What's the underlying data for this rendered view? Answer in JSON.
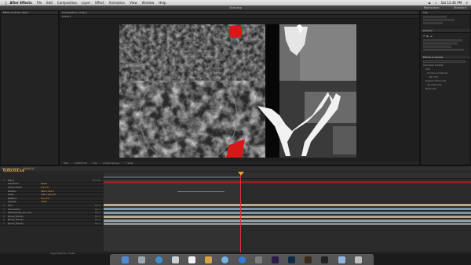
{
  "menubar": {
    "app": "After Effects",
    "items": [
      "File",
      "Edit",
      "Composition",
      "Layer",
      "Effect",
      "Animation",
      "View",
      "Window",
      "Help"
    ],
    "clock": "Sat 12:46 PM"
  },
  "titlebar": {
    "title": "Shot.aep",
    "workspace_label": "Workspace:",
    "workspace_value": "Standard"
  },
  "left_panel": {
    "tab": "Effect Controls: Kat_0"
  },
  "comp_panel": {
    "tab": "Composition: Comp 1",
    "subtab": "Comp 1"
  },
  "viewer_toolbar": {
    "zoom": "50%",
    "time": "0;00;03;16",
    "res": "Full",
    "camera": "Active Camera",
    "views": "1 View"
  },
  "right_panel": {
    "info_tab": "Info",
    "preview_tab": "Preview",
    "effects_tab": "Effects & Presets",
    "preset_items": [
      "Animation Presets",
      "Text",
      "Curves and Spirals",
      "Spin Out",
      "Organic Technicals",
      "3D Character",
      "Noise Gen"
    ]
  },
  "timeline": {
    "tabs": [
      "Render Queue",
      "Comp 1"
    ],
    "timecode": "0;00;03;16",
    "layers": [
      {
        "num": "1",
        "name": "Kat_0",
        "value": ""
      },
      {
        "num": "",
        "name": "Transform",
        "value": "Reset"
      },
      {
        "num": "",
        "name": "Anchor Point",
        "value": "0.0,0.0"
      },
      {
        "num": "",
        "name": "Position",
        "value": "960.0,540.0"
      },
      {
        "num": "",
        "name": "Scale",
        "value": "100.0,100.0%"
      },
      {
        "num": "",
        "name": "Rotation",
        "value": "0x+0.0°"
      },
      {
        "num": "",
        "name": "Opacity",
        "value": "100%"
      },
      {
        "num": "2",
        "name": "Grid",
        "value": ""
      },
      {
        "num": "3",
        "name": "Pixel Sorter",
        "value": ""
      },
      {
        "num": "4",
        "name": "[Photograph_01.mov]",
        "value": ""
      },
      {
        "num": "5",
        "name": "[Fixed_Frame]",
        "value": ""
      },
      {
        "num": "6",
        "name": "[Fixed_Frame]",
        "value": ""
      },
      {
        "num": "7",
        "name": "[Fixed_Frame]",
        "value": ""
      }
    ],
    "mode_label": "Normal",
    "parent_label": "None",
    "status": "Toggle Switches / Modes"
  },
  "colors": {
    "accent": "#e8a33a",
    "playhead": "#d33333",
    "track_blue": "#7b95a6",
    "track_tan": "#b9a88a",
    "track_gray": "#8a8a8a",
    "mask_red": "#d81818"
  },
  "dock_icons": [
    "finder-icon",
    "launchpad-icon",
    "safari-icon",
    "mail-icon",
    "calendar-icon",
    "photos-icon",
    "itunes-icon",
    "appstore-icon",
    "preferences-icon",
    "ae-icon",
    "ps-icon",
    "br-icon",
    "terminal-icon",
    "folder-icon",
    "trash-icon"
  ]
}
